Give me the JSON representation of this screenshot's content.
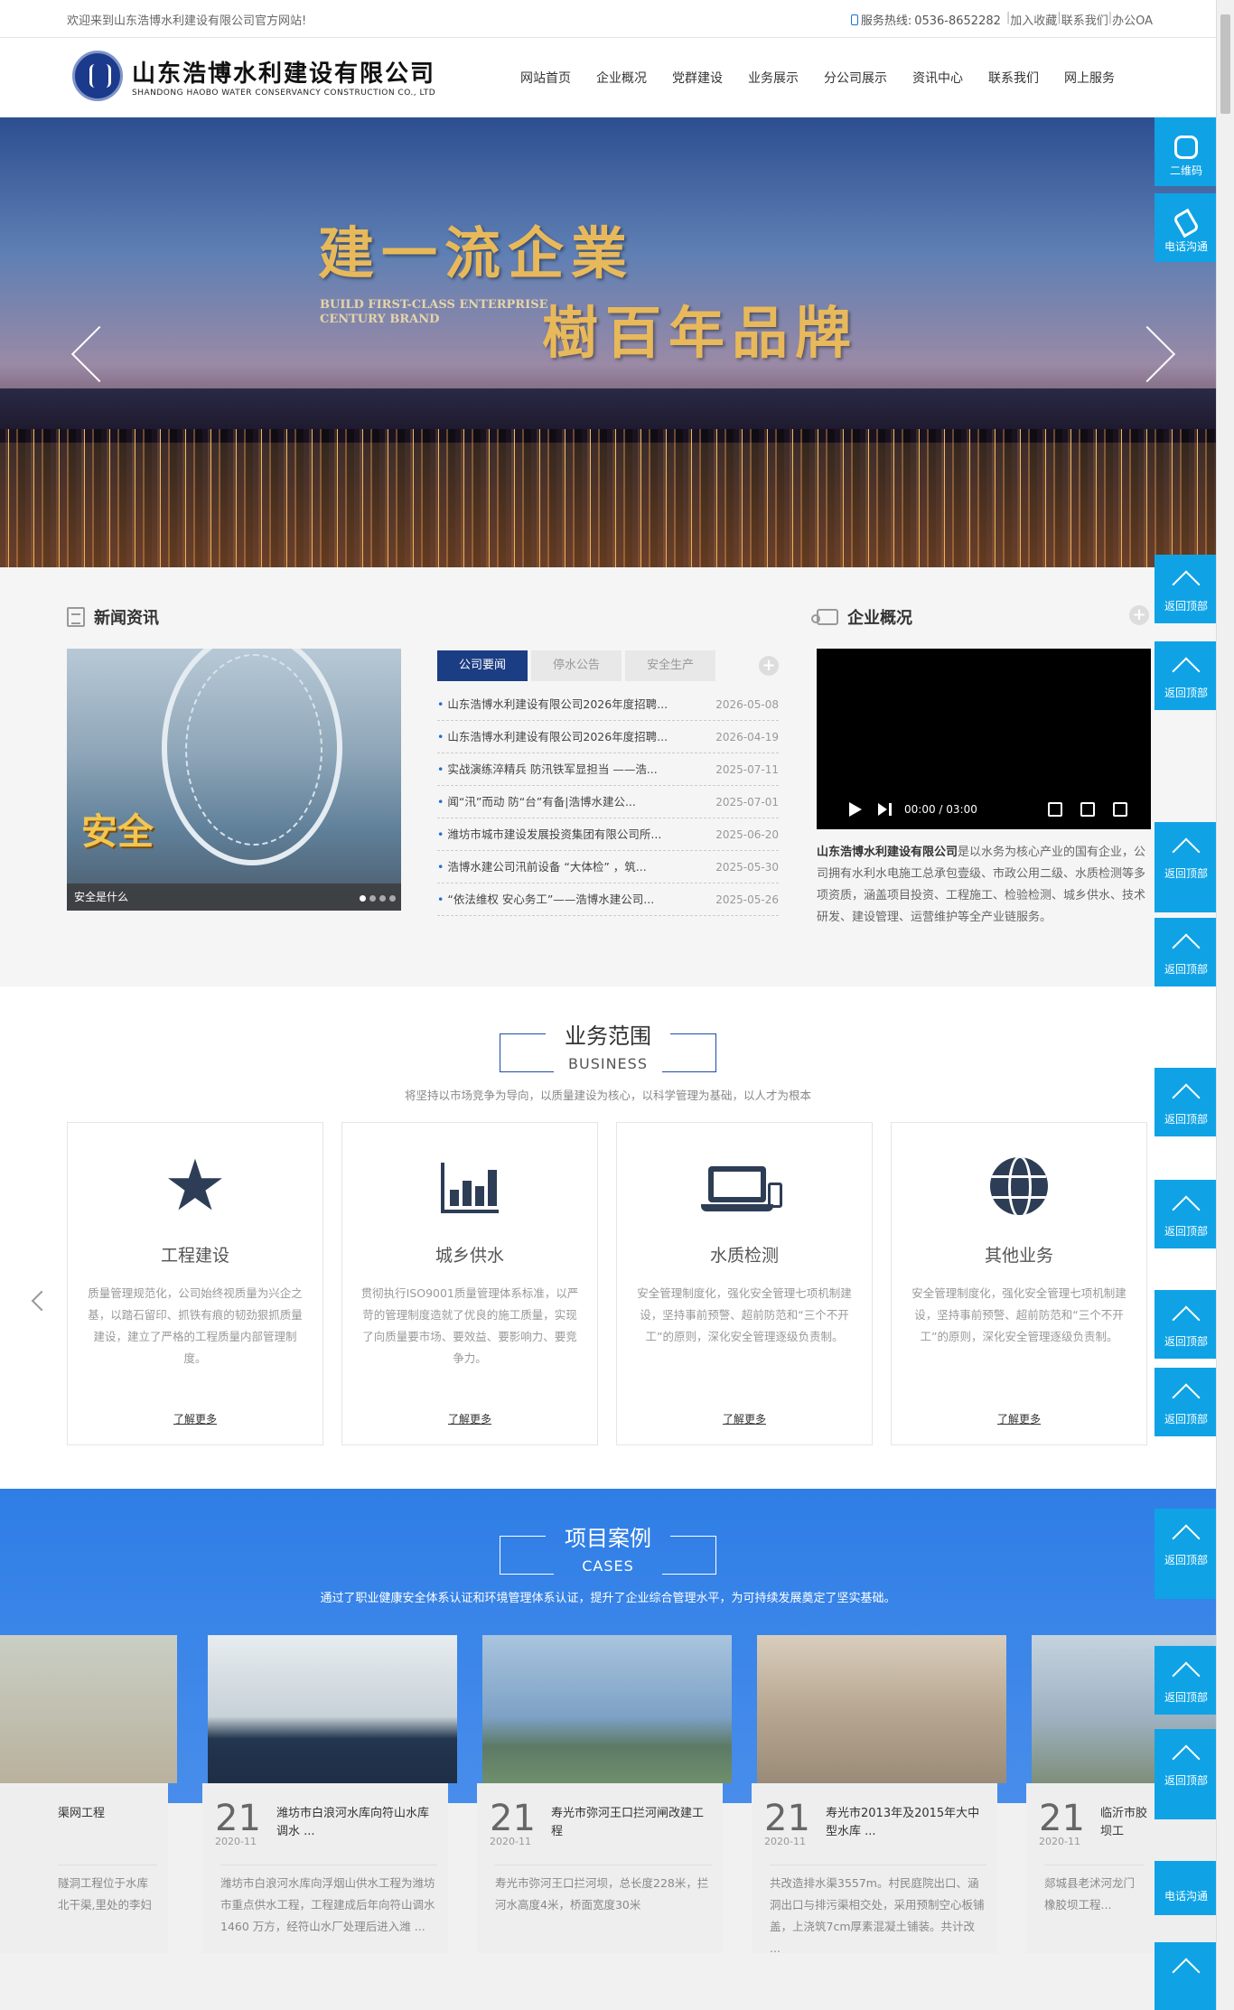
{
  "topbar": {
    "welcome": "欢迎来到山东浩博水利建设有限公司官方网站!",
    "hotline_label": "服务热线:",
    "hotline": "0536-8652282",
    "links": [
      "加入收藏",
      "联系我们",
      "办公OA"
    ]
  },
  "header": {
    "logo_cn": "山东浩博水利建设有限公司",
    "logo_en": "SHANDONG HAOBO WATER CONSERVANCY CONSTRUCTION CO., LTD",
    "nav": [
      "网站首页",
      "企业概况",
      "党群建设",
      "业务展示",
      "分公司展示",
      "资讯中心",
      "联系我们",
      "网上服务"
    ]
  },
  "banner": {
    "slogan_line1": "建一流企業",
    "slogan_line2": "樹百年品牌",
    "slogan_en1": "BUILD FIRST-CLASS ENTERPRISE",
    "slogan_en2": "CENTURY BRAND"
  },
  "news": {
    "title": "新闻资讯",
    "image_caption": "安全是什么",
    "image_text": "安全",
    "tabs": [
      "公司要闻",
      "停水公告",
      "安全生产"
    ],
    "items": [
      {
        "title": "山东浩博水利建设有限公司2026年度招聘...",
        "date": "2026-05-08"
      },
      {
        "title": "山东浩博水利建设有限公司2026年度招聘...",
        "date": "2026-04-19"
      },
      {
        "title": "实战演练淬精兵 防汛铁军显担当 ——浩...",
        "date": "2025-07-11"
      },
      {
        "title": "闻“汛”而动 防“台”有备|浩博水建公...",
        "date": "2025-07-01"
      },
      {
        "title": "潍坊市城市建设发展投资集团有限公司所...",
        "date": "2025-06-20"
      },
      {
        "title": "浩博水建公司汛前设备 “大体检” ，筑...",
        "date": "2025-05-30"
      },
      {
        "title": "“依法维权 安心务工”——浩博水建公司...",
        "date": "2025-05-26"
      }
    ]
  },
  "company": {
    "title": "企业概况",
    "video_time": "00:00 / 03:00",
    "intro_name": "山东浩博水利建设有限公司",
    "intro_text": "是以水务为核心产业的国有企业，公司拥有水利水电施工总承包壹级、市政公用二级、水质检测等多项资质，涵盖项目投资、工程施工、检验检测、城乡供水、技术研发、建设管理、运营维护等全产业链服务。"
  },
  "business": {
    "title_cn": "业务范围",
    "title_en": "BUSINESS",
    "subtitle": "将坚持以市场竞争为导向，以质量建设为核心，以科学管理为基础，以人才为根本",
    "cards": [
      {
        "name": "工程建设",
        "icon": "star-icon",
        "desc": "质量管理规范化，公司始终视质量为兴企之基，以踏石留印、抓铁有痕的韧劲狠抓质量建设，建立了严格的工程质量内部管理制度。",
        "more": "了解更多"
      },
      {
        "name": "城乡供水",
        "icon": "bar-chart-icon",
        "desc": "贯彻执行ISO9001质量管理体系标准，以严苛的管理制度造就了优良的施工质量，实现了向质量要市场、要效益、要影响力、要竞争力。",
        "more": "了解更多"
      },
      {
        "name": "水质检测",
        "icon": "laptop-icon",
        "desc": "安全管理制度化，强化安全管理七项机制建设，坚持事前预警、超前防范和“三个不开工”的原则，深化安全管理逐级负责制。",
        "more": "了解更多"
      },
      {
        "name": "其他业务",
        "icon": "globe-icon",
        "desc": "安全管理制度化，强化安全管理七项机制建设，坚持事前预警、超前防范和“三个不开工”的原则，深化安全管理逐级负责制。",
        "more": "了解更多"
      }
    ]
  },
  "cases": {
    "title_cn": "项目案例",
    "title_en": "CASES",
    "subtitle": "通过了职业健康安全体系认证和环境管理体系认证，提升了企业综合管理水平，为可持续发展奠定了坚实基础。",
    "items": [
      {
        "day": "",
        "ym": "",
        "title": "渠网工程",
        "desc": "隧洞工程位于水库北干渠,里处的李妇"
      },
      {
        "day": "21",
        "ym": "2020-11",
        "title": "潍坊市白浪河水库向符山水库调水 ...",
        "desc": "潍坊市白浪河水库向浮烟山供水工程为潍坊市重点供水工程，工程建成后年向符山调水1460 万方，经符山水厂处理后进入潍 ..."
      },
      {
        "day": "21",
        "ym": "2020-11",
        "title": "寿光市弥河王口拦河闸改建工程",
        "desc": "寿光市弥河王口拦河坝，总长度228米，拦河水高度4米，桥面宽度30米"
      },
      {
        "day": "21",
        "ym": "2020-11",
        "title": "寿光市2013年及2015年大中型水库 ...",
        "desc": "共改造排水渠3557m。村民庭院出口、涵洞出口与排污渠相交处，采用预制空心板铺盖，上浇筑7cm厚素混凝土铺装。共计改 ..."
      },
      {
        "day": "21",
        "ym": "2020-11",
        "title": "临沂市胶坝工",
        "desc": "郯城县老沭河龙门橡胶坝工程..."
      }
    ]
  },
  "float": {
    "qr_label": "二维码",
    "tel_label": "电话沟通",
    "top_label": "返回顶部"
  },
  "colors": {
    "brand_blue": "#1b3d84",
    "float_blue": "#0fa3e6",
    "cases_blue": "#2e7ee6"
  }
}
